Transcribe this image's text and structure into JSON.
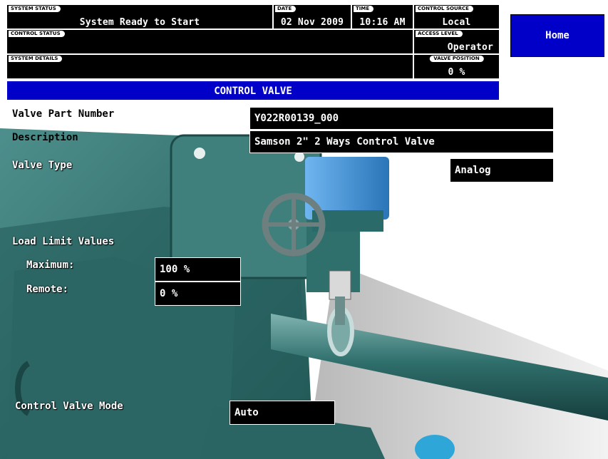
{
  "status": {
    "system_status": {
      "caption": "SYSTEM STATUS",
      "value": "System Ready to Start"
    },
    "date": {
      "caption": "DATE",
      "value": "02 Nov 2009"
    },
    "time": {
      "caption": "TIME",
      "value": "10:16 AM"
    },
    "control_source": {
      "caption": "CONTROL SOURCE",
      "value": "Local"
    },
    "control_status": {
      "caption": "CONTROL STATUS",
      "value": ""
    },
    "access_level": {
      "caption": "ACCESS LEVEL",
      "value": "Operator"
    },
    "system_details": {
      "caption": "SYSTEM DETAILS",
      "value": ""
    },
    "valve_position": {
      "caption": "VALVE POSITION",
      "value": "0 %"
    }
  },
  "nav": {
    "home_label": "Home"
  },
  "page": {
    "title": "CONTROL VALVE"
  },
  "valve": {
    "part_number": {
      "label": "Valve Part Number",
      "value": "Y022R00139_000"
    },
    "description": {
      "label": "Description",
      "value": "Samson 2\" 2 Ways Control Valve"
    },
    "type": {
      "label": "Valve Type",
      "value": "Analog"
    }
  },
  "load_limits": {
    "heading": "Load Limit Values",
    "maximum": {
      "label": "Maximum:",
      "value": "100 %"
    },
    "remote": {
      "label": "Remote:",
      "value": "0 %"
    }
  },
  "mode": {
    "label": "Control Valve Mode",
    "value": "Auto"
  },
  "colors": {
    "header_bg": "#000000",
    "accent_blue": "#0000c8",
    "machine_teal": "#2e6f6e",
    "actuator_blue": "#3a8fd8"
  }
}
